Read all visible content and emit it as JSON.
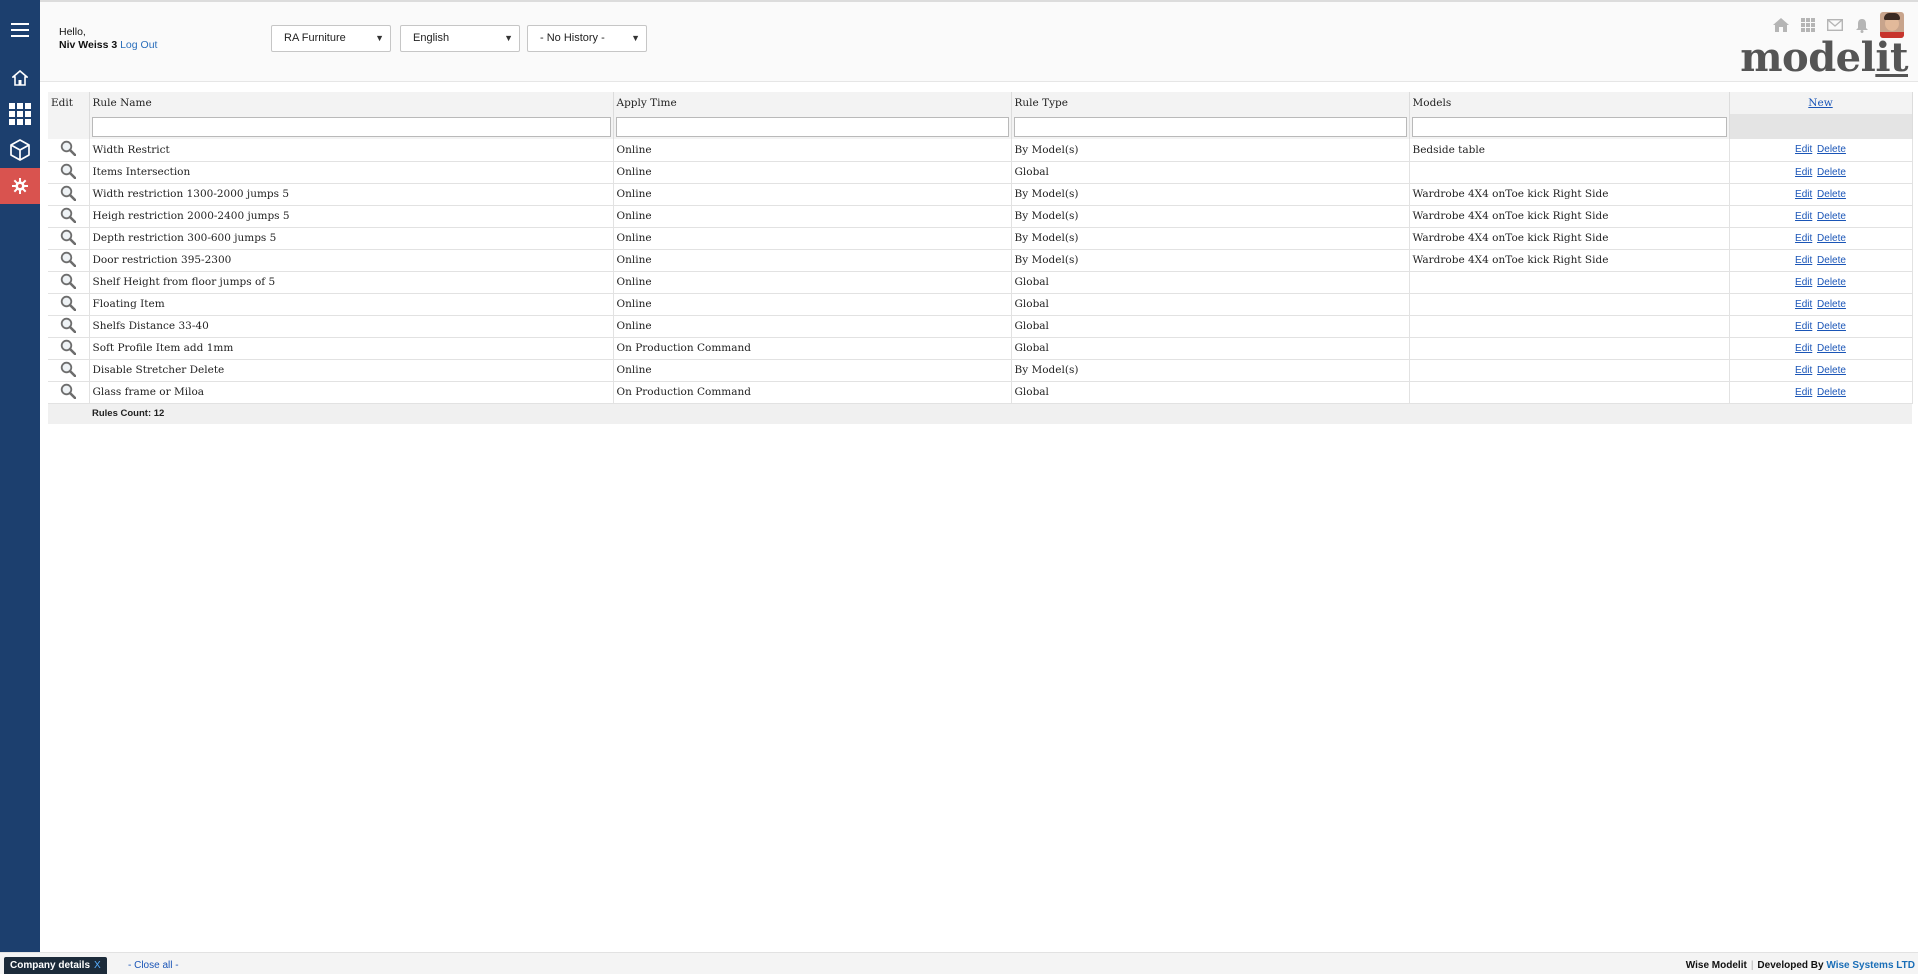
{
  "header": {
    "greeting": "Hello,",
    "user_name": "Niv Weiss 3",
    "logout_label": "Log Out",
    "company_select": "RA Furniture",
    "language_select": "English",
    "history_select": "- No History -",
    "logo_text_main": "model",
    "logo_text_it": "it"
  },
  "sidebar": {
    "items": [
      "menu-icon",
      "home-icon",
      "grid-icon",
      "cube-icon",
      "gear-icon"
    ],
    "active_color": "#d9534f",
    "bg_color": "#1c3f6e"
  },
  "grid": {
    "columns": {
      "edit": "Edit",
      "rule_name": "Rule Name",
      "apply_time": "Apply Time",
      "rule_type": "Rule Type",
      "models": "Models",
      "new": "New"
    },
    "action_edit": "Edit",
    "action_delete": "Delete",
    "rows": [
      {
        "name": "Width Restrict",
        "apply": "Online",
        "type": "By Model(s)",
        "models": "Bedside table"
      },
      {
        "name": "Items Intersection",
        "apply": "Online",
        "type": "Global",
        "models": ""
      },
      {
        "name": "Width restriction 1300-2000 jumps 5",
        "apply": "Online",
        "type": "By Model(s)",
        "models": "Wardrobe 4X4 onToe kick Right Side"
      },
      {
        "name": "Heigh restriction 2000-2400 jumps 5",
        "apply": "Online",
        "type": "By Model(s)",
        "models": "Wardrobe 4X4 onToe kick Right Side"
      },
      {
        "name": "Depth restriction 300-600 jumps 5",
        "apply": "Online",
        "type": "By Model(s)",
        "models": "Wardrobe 4X4 onToe kick Right Side"
      },
      {
        "name": "Door restriction 395-2300",
        "apply": "Online",
        "type": "By Model(s)",
        "models": "Wardrobe 4X4 onToe kick Right Side"
      },
      {
        "name": "Shelf Height from floor jumps of 5",
        "apply": "Online",
        "type": "Global",
        "models": ""
      },
      {
        "name": "Floating Item",
        "apply": "Online",
        "type": "Global",
        "models": ""
      },
      {
        "name": "Shelfs Distance 33-40",
        "apply": "Online",
        "type": "Global",
        "models": ""
      },
      {
        "name": "Soft Profile Item add 1mm",
        "apply": "On Production Command",
        "type": "Global",
        "models": ""
      },
      {
        "name": "Disable Stretcher Delete",
        "apply": "Online",
        "type": "By Model(s)",
        "models": ""
      },
      {
        "name": "Glass frame or Miloa",
        "apply": "On Production Command",
        "type": "Global",
        "models": ""
      }
    ],
    "footer": "Rules Count: 12"
  },
  "bottombar": {
    "tab_label": "Company details",
    "tab_close": "X",
    "close_all": "- Close all -",
    "product": "Wise Modelit",
    "developed_by": "Developed By",
    "company": "Wise Systems LTD"
  }
}
